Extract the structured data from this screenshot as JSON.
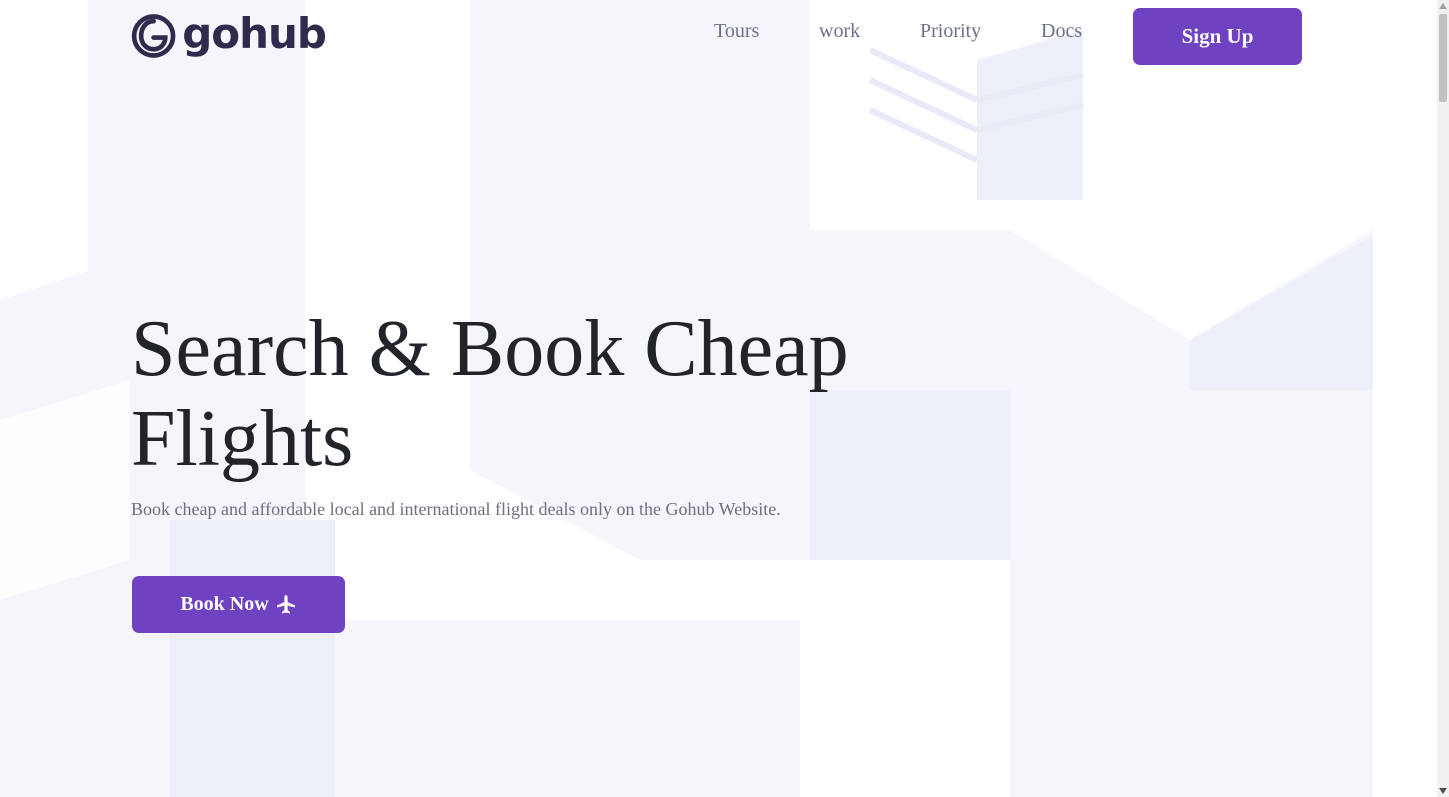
{
  "brand": {
    "name": "gohub",
    "primary_color": "#6f42c1",
    "logo_color": "#2e2b4d"
  },
  "nav": {
    "items": [
      {
        "label": "Tours"
      },
      {
        "label": "work"
      },
      {
        "label": "Priority"
      },
      {
        "label": "Docs"
      }
    ],
    "signup_label": "Sign Up"
  },
  "hero": {
    "title": "Search & Book Cheap Flights",
    "subtitle": "Book cheap and affordable local and international flight deals only on the Gohub Website.",
    "cta_label": "Book Now",
    "cta_icon": "plane-icon"
  }
}
